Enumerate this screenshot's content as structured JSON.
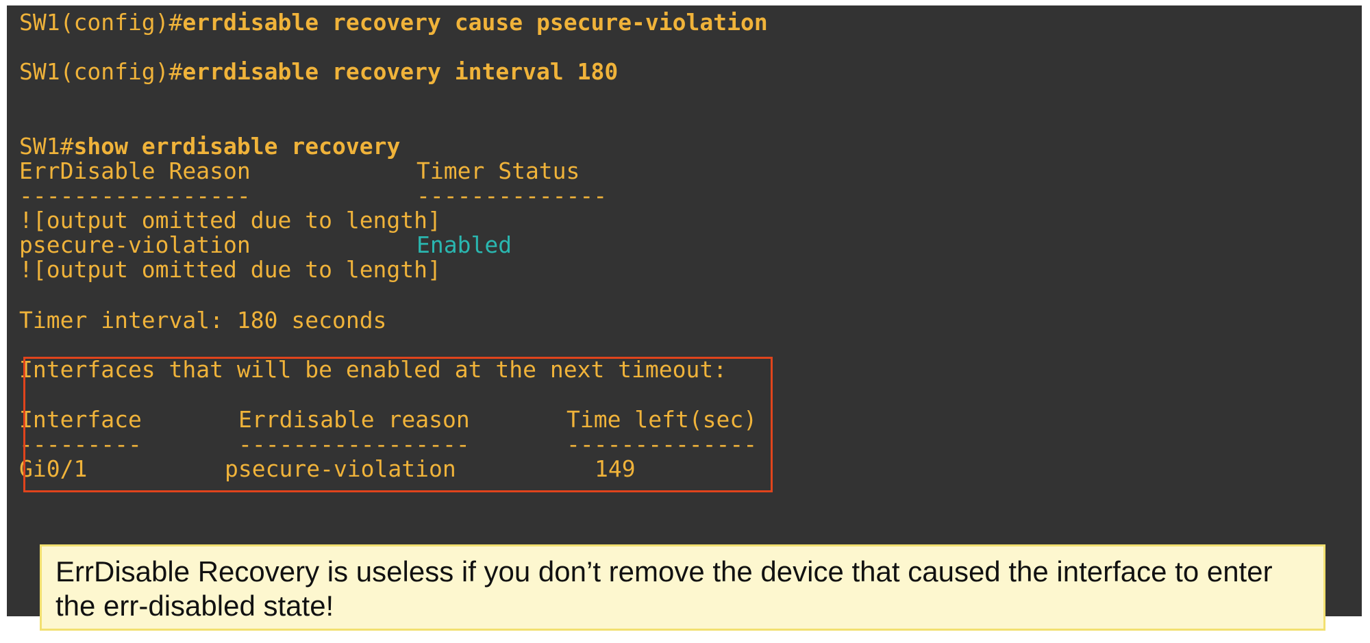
{
  "terminal": {
    "prompt_config": "SW1(config)#",
    "cmd1": "errdisable recovery cause psecure-violation",
    "cmd2": "errdisable recovery interval 180",
    "prompt_exec": "SW1#",
    "cmd3": "show errdisable recovery",
    "header_reason": "ErrDisable Reason",
    "header_status": "Timer Status",
    "divider_reason": "-----------------",
    "divider_status": "--------------",
    "omitted": "![output omitted due to length]",
    "row_reason": "psecure-violation",
    "row_status": "Enabled",
    "timer_interval": "Timer interval: 180 seconds",
    "interfaces_heading": "Interfaces that will be enabled at the next timeout:",
    "col_interface": "Interface",
    "col_reason": "Errdisable reason",
    "col_time": "Time left(sec)",
    "div_interface": "---------",
    "div_reason": "-----------------",
    "div_time": "--------------",
    "entry_interface": "Gi0/1",
    "entry_reason": "psecure-violation",
    "entry_time": "149"
  },
  "callout": {
    "text": "ErrDisable Recovery is useless if you don’t remove the device that caused the interface to enter the err-disabled state!"
  },
  "colors": {
    "terminal_bg": "#333333",
    "text": "#f0b33a",
    "enabled": "#2ab7b0",
    "highlight_border": "#e0441c",
    "callout_bg": "#fdf7cf",
    "callout_border": "#f2e070"
  }
}
